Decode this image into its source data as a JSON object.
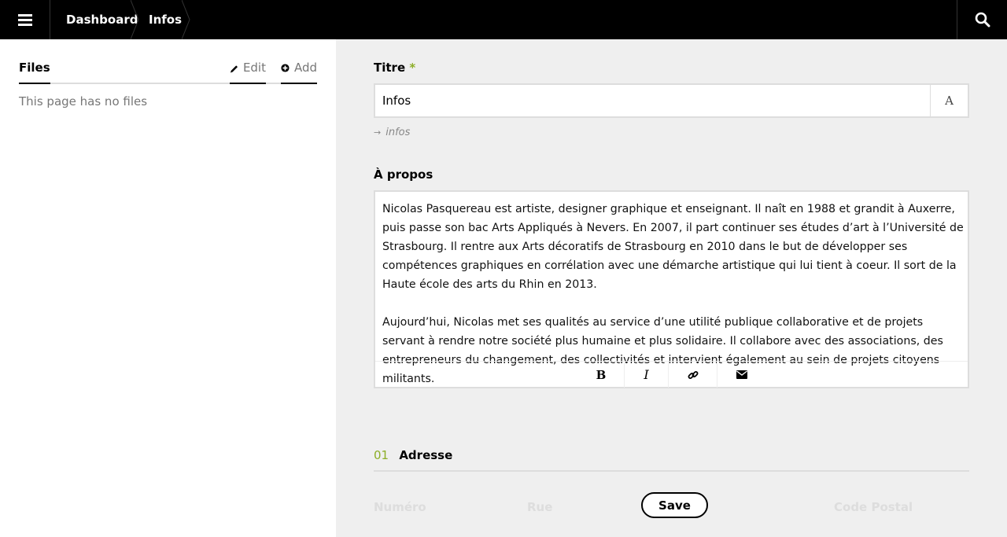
{
  "header": {
    "menu_icon": "hamburger-icon",
    "breadcrumbs": [
      "Dashboard",
      "Infos"
    ],
    "search_icon": "search-icon"
  },
  "sidebar": {
    "files_title": "Files",
    "edit_label": "Edit",
    "add_label": "Add",
    "empty_text": "This page has no files"
  },
  "form": {
    "titre_label": "Titre",
    "required_mark": "*",
    "titre_value": "Infos",
    "format_button": "A",
    "slug_arrow": "→",
    "slug": "infos",
    "apropos_label": "À propos",
    "apropos_p1": "Nicolas Pasquereau est artiste, designer graphique et enseignant. Il naît en 1988 et grandit à Auxerre, puis passe son bac Arts Appliqués à Nevers. En 2007, il part continuer ses études d’art à l’Université de Strasbourg. Il rentre aux Arts décoratifs de Strasbourg en 2010 dans le but de développer ses compétences graphiques en corrélation avec une démarche artistique qui lui tient à coeur. Il sort de la Haute école des arts du Rhin en 2013.",
    "apropos_p2": "Aujourd’hui, Nicolas met ses qualités au service d’une utilité publique collaborative et de projets servant à rendre notre société plus humaine et plus solidaire. Il collabore avec des associations, des entrepreneurs du changement, des collectivités et intervient également au sein de projets citoyens militants.",
    "toolbar": {
      "bold": "B",
      "italic": "I",
      "link_icon": "link-icon",
      "email_icon": "envelope-icon"
    },
    "section_number": "01",
    "section_title": "Adresse",
    "fields": [
      "Numéro",
      "Rue",
      "Code Postal"
    ],
    "save_label": "Save"
  },
  "colors": {
    "topbar": "#000000",
    "accent": "#8dae28",
    "sidebar": "#ffffff",
    "main": "#efefef"
  }
}
